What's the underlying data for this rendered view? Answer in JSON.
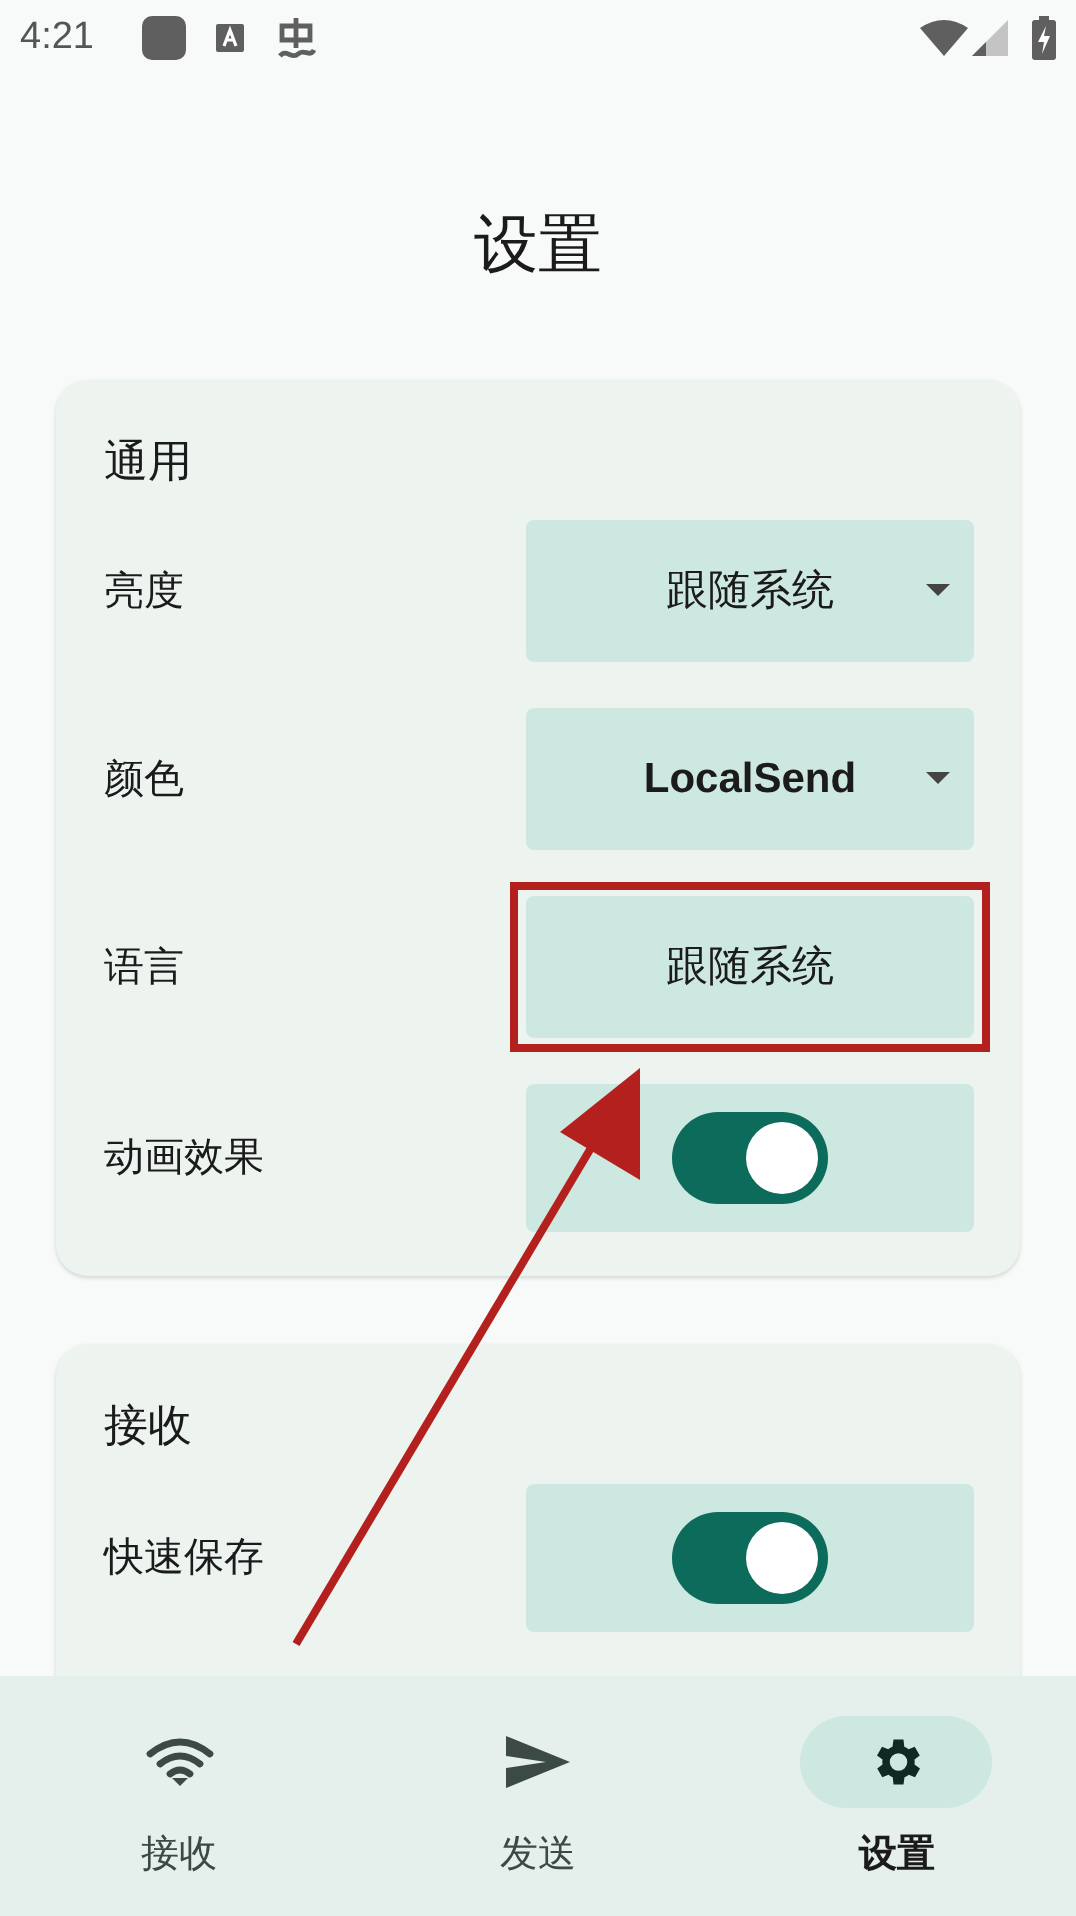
{
  "status_bar": {
    "time": "4:21"
  },
  "title": "设置",
  "sections": [
    {
      "title": "通用",
      "rows": [
        {
          "label": "亮度",
          "kind": "dropdown",
          "value": "跟随系统",
          "bold": false
        },
        {
          "label": "颜色",
          "kind": "dropdown",
          "value": "LocalSend",
          "bold": true
        },
        {
          "label": "语言",
          "kind": "button",
          "value": "跟随系统",
          "highlighted": true
        },
        {
          "label": "动画效果",
          "kind": "switch",
          "on": true
        }
      ]
    },
    {
      "title": "接收",
      "rows": [
        {
          "label": "快速保存",
          "kind": "switch",
          "on": true
        }
      ]
    }
  ],
  "nav": [
    {
      "label": "接收",
      "selected": false
    },
    {
      "label": "发送",
      "selected": false
    },
    {
      "label": "设置",
      "selected": true
    }
  ]
}
